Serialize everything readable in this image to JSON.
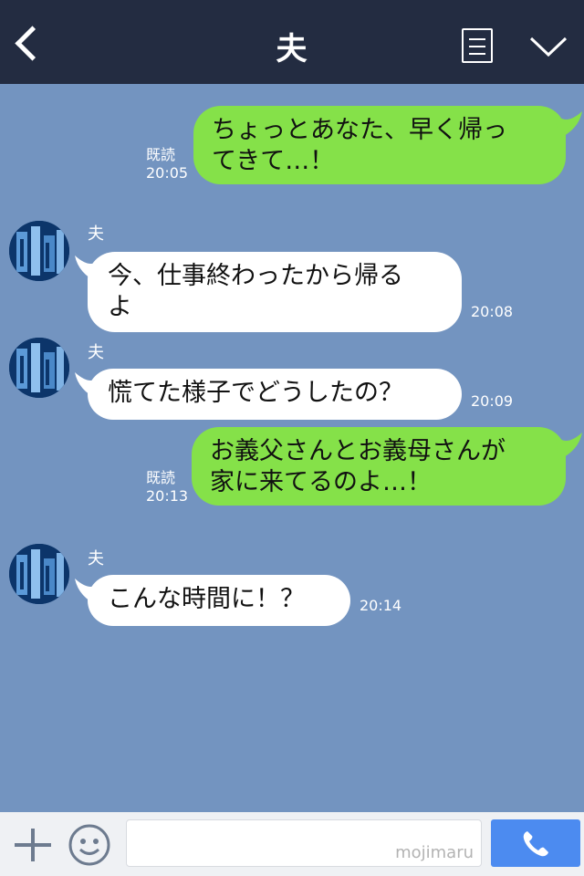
{
  "header": {
    "title": "夫",
    "bar_color": "#232c41"
  },
  "colors": {
    "chat_background": "#7394c0",
    "sent_bubble": "#85e149",
    "received_bubble": "#ffffff",
    "call_button": "#4c8bf0"
  },
  "messages": [
    {
      "type": "sent",
      "text": "ちょっとあなた、早く帰っ\nてきて…！",
      "read": "既読",
      "time": "20:05"
    },
    {
      "type": "received",
      "sender": "夫",
      "text": "今、仕事終わったから帰る\nよ",
      "time": "20:08"
    },
    {
      "type": "received",
      "sender": "夫",
      "text": "慌てた様子でどうしたの？",
      "time": "20:09"
    },
    {
      "type": "sent",
      "text": "お義父さんとお義母さんが\n家に来てるのよ…！",
      "read": "既読",
      "time": "20:13"
    },
    {
      "type": "received",
      "sender": "夫",
      "text": "こんな時間に！？",
      "time": "20:14"
    }
  ],
  "footer": {
    "watermark": "mojimaru",
    "icons": [
      "plus-icon",
      "emoji-icon",
      "phone-icon"
    ]
  }
}
